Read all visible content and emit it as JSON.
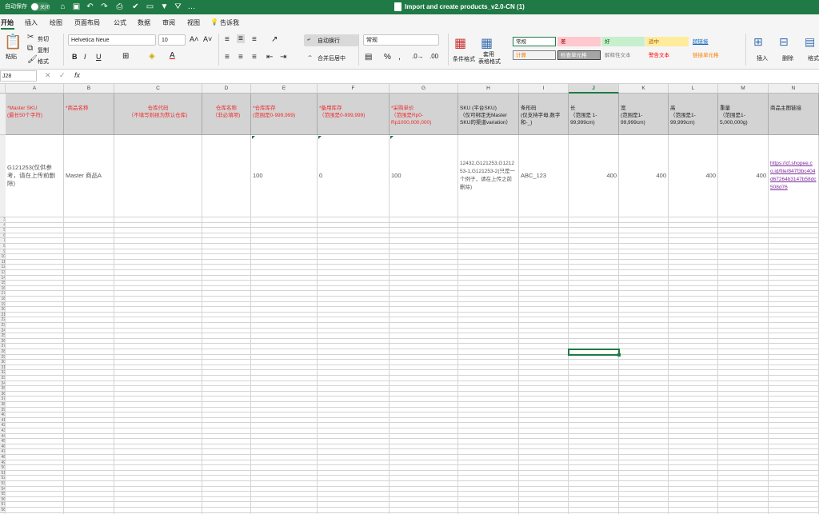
{
  "titlebar": {
    "autosave_label": "自动保存",
    "autosave_state": "关闭",
    "document_title": "Import and create products_v2.0-CN (1)",
    "icons": [
      "home-icon",
      "save-icon",
      "undo-icon",
      "redo-icon",
      "print-icon",
      "filter-icon",
      "more-icon"
    ]
  },
  "tabs": [
    "开始",
    "插入",
    "绘图",
    "页面布局",
    "公式",
    "数据",
    "审阅",
    "视图"
  ],
  "tell_me": "告诉我",
  "ribbon": {
    "paste": "粘贴",
    "cut": "剪切",
    "copy": "复制",
    "format_painter": "格式",
    "font_name": "Helvetica Neue",
    "font_size": "10",
    "wrap_text": "自动换行",
    "merge_center": "合并后居中",
    "number_format": "常规",
    "conditional_format": "条件格式",
    "table_format_1": "套用",
    "table_format_2": "表格格式",
    "styles": [
      {
        "label": "常规",
        "bg": "#ffffff",
        "fg": "#222222",
        "border": "#1f7a45"
      },
      {
        "label": "差",
        "bg": "#ffc7ce",
        "fg": "#9c0006",
        "border": "transparent"
      },
      {
        "label": "好",
        "bg": "#c6efce",
        "fg": "#006100",
        "border": "transparent"
      },
      {
        "label": "适中",
        "bg": "#ffeb9c",
        "fg": "#9c5700",
        "border": "transparent"
      },
      {
        "label": "超链接",
        "bg": "#f5f5f5",
        "fg": "#0563c1",
        "border": "transparent"
      },
      {
        "label": "计算",
        "bg": "#f2f2f2",
        "fg": "#fa7d00",
        "border": "#7f7f7f"
      },
      {
        "label": "检查单元格",
        "bg": "#a5a5a5",
        "fg": "#ffffff",
        "border": "#3f3f3f"
      },
      {
        "label": "解释性文本",
        "bg": "#f5f5f5",
        "fg": "#7f7f7f",
        "border": "transparent"
      },
      {
        "label": "警告文本",
        "bg": "#f5f5f5",
        "fg": "#ff0000",
        "border": "transparent"
      },
      {
        "label": "链接单元格",
        "bg": "#f5f5f5",
        "fg": "#fa7d00",
        "border": "transparent"
      }
    ],
    "insert": "插入",
    "delete": "删除",
    "format": "格式"
  },
  "formula_bar": {
    "name_box": "J28",
    "fx": "fx",
    "content": ""
  },
  "columns": [
    "A",
    "B",
    "C",
    "D",
    "E",
    "F",
    "G",
    "H",
    "I",
    "J",
    "K",
    "L",
    "M",
    "N"
  ],
  "header_row": [
    {
      "text": "*Master SKU\n(最长50个字符)",
      "color": "red"
    },
    {
      "text": "*商品名称",
      "color": "red"
    },
    {
      "text": "仓库代码\n（不填写则视为默认仓库)",
      "color": "red"
    },
    {
      "text": "仓库名称\n（非必填项)",
      "color": "red"
    },
    {
      "text": "*仓库库存\n(范围是0-999,999)",
      "color": "red"
    },
    {
      "text": "*备用库存\n（范围是0-999,999)",
      "color": "red"
    },
    {
      "text": "*采购单价\n（范围是Rp0-Rp1000,000,000)",
      "color": "red"
    },
    {
      "text": "SKU (平台SKU)\n（仅可绑定无Master SKU的渠道variation）",
      "color": "black"
    },
    {
      "text": "条形码\n(仅支持字母,数字和-_)",
      "color": "black"
    },
    {
      "text": "长\n（范围是 1-99,999cm)",
      "color": "black"
    },
    {
      "text": "宽\n(范围是1-99,999cm)",
      "color": "black"
    },
    {
      "text": "高\n（范围是1-99,999cm)",
      "color": "black"
    },
    {
      "text": "重量\n（范围是1-5,000,000g)",
      "color": "black"
    },
    {
      "text": "商品主图链接",
      "color": "black"
    }
  ],
  "data_row": [
    "G121253(仅供参考，请在上传前删除)",
    "Master 商品A",
    "",
    "",
    "100",
    "0",
    "100",
    "12432,G121253,G121253-1,G121253-2(只是一个例子，请在上传之前删除)",
    "ABC_123",
    "400",
    "400",
    "400",
    "400",
    "https://cf.shopee.co.id/file/847f3bc404d67264b3147b58dc508d76"
  ],
  "row_numbers_visible": [
    1,
    2,
    3,
    4,
    5,
    6,
    7,
    8,
    9,
    10,
    11,
    12,
    13,
    14,
    15,
    16,
    17,
    18,
    19,
    20,
    21,
    22,
    23,
    24,
    25,
    26,
    27,
    28,
    29,
    30,
    31,
    32,
    33,
    34,
    35,
    36,
    37,
    38,
    39,
    40,
    41,
    42,
    43,
    44,
    45,
    46,
    47,
    48,
    49,
    50,
    51,
    52,
    53,
    54,
    55,
    56,
    57,
    58,
    59,
    60,
    61,
    62,
    63
  ],
  "selected_cell": "J28"
}
